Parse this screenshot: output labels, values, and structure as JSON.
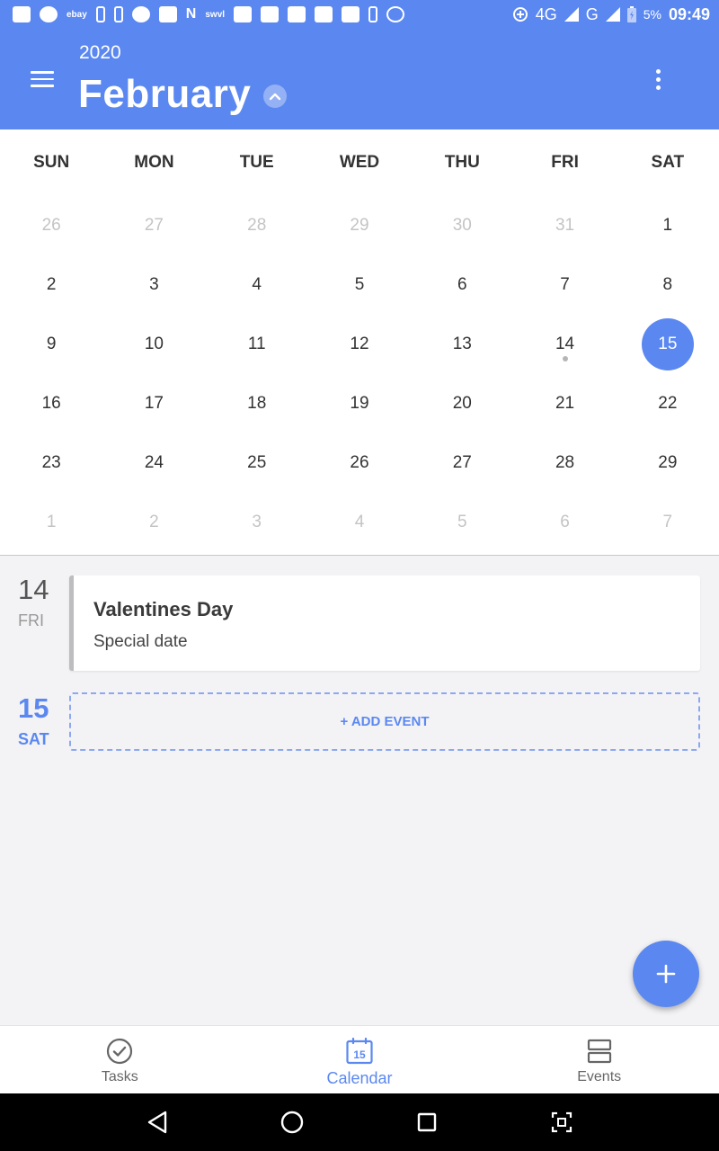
{
  "status_bar": {
    "time": "09:49",
    "battery": "5%",
    "network_4g": "4G",
    "network_g": "G",
    "left_icons": [
      "whatsapp-icon",
      "chrome-icon",
      "ebay-icon",
      "usb-icon",
      "usb-icon",
      "swirl-icon",
      "image-icon",
      "n-icon",
      "swvl-icon",
      "youtube-icon",
      "youtube-icon",
      "youtube-icon",
      "youtube-icon",
      "youtube-icon",
      "usb-icon",
      "free-icon"
    ],
    "ebay_label": "ebay",
    "swvl_label": "swvl"
  },
  "app_bar": {
    "year": "2020",
    "month": "February"
  },
  "calendar": {
    "weekdays": [
      "SUN",
      "MON",
      "TUE",
      "WED",
      "THU",
      "FRI",
      "SAT"
    ],
    "weeks": [
      [
        {
          "d": "26",
          "m": true
        },
        {
          "d": "27",
          "m": true
        },
        {
          "d": "28",
          "m": true
        },
        {
          "d": "29",
          "m": true
        },
        {
          "d": "30",
          "m": true
        },
        {
          "d": "31",
          "m": true
        },
        {
          "d": "1"
        }
      ],
      [
        {
          "d": "2"
        },
        {
          "d": "3"
        },
        {
          "d": "4"
        },
        {
          "d": "5"
        },
        {
          "d": "6"
        },
        {
          "d": "7"
        },
        {
          "d": "8"
        }
      ],
      [
        {
          "d": "9"
        },
        {
          "d": "10"
        },
        {
          "d": "11"
        },
        {
          "d": "12"
        },
        {
          "d": "13"
        },
        {
          "d": "14",
          "dot": true
        },
        {
          "d": "15",
          "selected": true
        }
      ],
      [
        {
          "d": "16"
        },
        {
          "d": "17"
        },
        {
          "d": "18"
        },
        {
          "d": "19"
        },
        {
          "d": "20"
        },
        {
          "d": "21"
        },
        {
          "d": "22"
        }
      ],
      [
        {
          "d": "23"
        },
        {
          "d": "24"
        },
        {
          "d": "25"
        },
        {
          "d": "26"
        },
        {
          "d": "27"
        },
        {
          "d": "28"
        },
        {
          "d": "29"
        }
      ],
      [
        {
          "d": "1",
          "m": true
        },
        {
          "d": "2",
          "m": true
        },
        {
          "d": "3",
          "m": true
        },
        {
          "d": "4",
          "m": true
        },
        {
          "d": "5",
          "m": true
        },
        {
          "d": "6",
          "m": true
        },
        {
          "d": "7",
          "m": true
        }
      ]
    ]
  },
  "events": {
    "day1": {
      "date_num": "14",
      "date_name": "FRI",
      "title": "Valentines Day",
      "subtitle": "Special date"
    },
    "day2": {
      "date_num": "15",
      "date_name": "SAT",
      "add_label": "+ ADD EVENT"
    }
  },
  "bottom_nav": {
    "tasks": "Tasks",
    "calendar": "Calendar",
    "calendar_icon_num": "15",
    "events": "Events"
  },
  "colors": {
    "accent": "#5b88f0",
    "background": "#f3f3f6"
  }
}
